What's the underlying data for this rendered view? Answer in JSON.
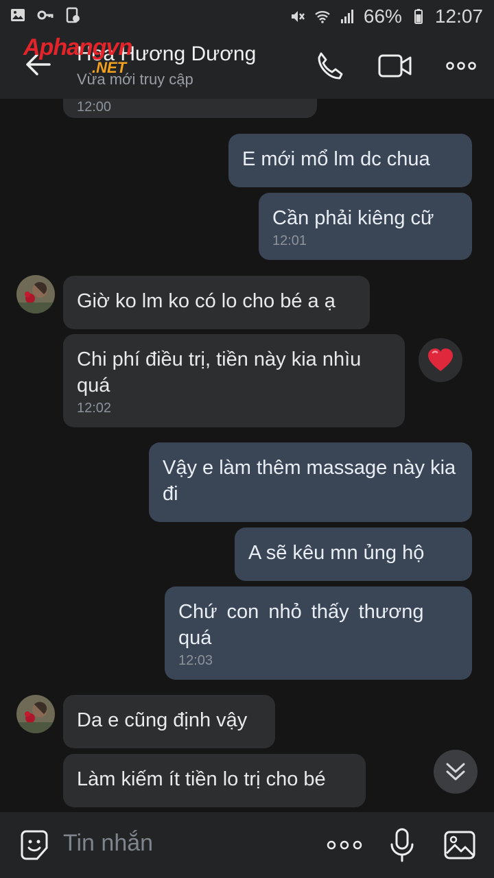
{
  "status_bar": {
    "battery": "66%",
    "time": "12:07",
    "icons": [
      "image-icon",
      "key-icon",
      "phone-data-icon",
      "mute-icon",
      "wifi-icon",
      "signal-icon",
      "battery-icon"
    ]
  },
  "header": {
    "contact_name": "Hoa Hương Dương",
    "status": "Vừa mới truy cập",
    "watermark_main": "Aphangvn",
    "watermark_sub": ".NET"
  },
  "messages": [
    {
      "dir": "in",
      "text": "",
      "time": "12:00"
    },
    {
      "dir": "out",
      "text": "E mới  mổ  lm dc chua",
      "time": ""
    },
    {
      "dir": "out",
      "text": "Cần phải  kiêng cữ",
      "time": "12:01"
    },
    {
      "dir": "in",
      "text": "Giờ ko lm ko có lo cho bé a ạ",
      "time": ""
    },
    {
      "dir": "in",
      "text": "Chi phí điều trị, tiền này kia nhìu quá",
      "time": "12:02",
      "reaction": "❤️"
    },
    {
      "dir": "out",
      "text": "Vậy e làm thêm  massage này kia đi",
      "time": ""
    },
    {
      "dir": "out",
      "text": "A sẽ  kêu  mn ủng hộ",
      "time": ""
    },
    {
      "dir": "out",
      "text": "Chứ  con  nhỏ  thấy  thương quá",
      "time": "12:03"
    },
    {
      "dir": "in",
      "text": "Da e cũng định vậy",
      "time": ""
    },
    {
      "dir": "in",
      "text": "Làm kiếm ít tiền lo trị cho bé",
      "time": ""
    }
  ],
  "composer": {
    "placeholder": "Tin nhắn"
  },
  "colors": {
    "background": "#151515",
    "bar": "#232425",
    "bubble_in": "#2d2e30",
    "bubble_out": "#3a4556"
  }
}
